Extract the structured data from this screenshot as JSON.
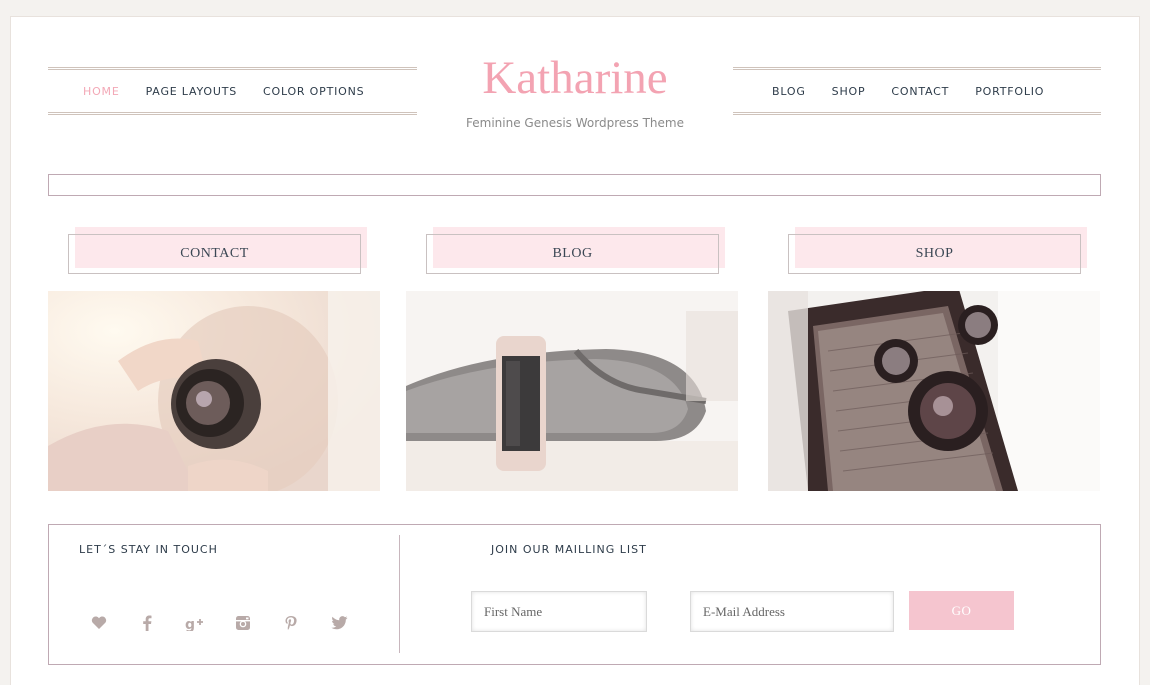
{
  "site": {
    "title": "Katharine",
    "tagline": "Feminine Genesis Wordpress Theme"
  },
  "nav_left": [
    {
      "label": "HOME",
      "active": true
    },
    {
      "label": "PAGE LAYOUTS",
      "active": false
    },
    {
      "label": "COLOR OPTIONS",
      "active": false
    }
  ],
  "nav_right": [
    {
      "label": "BLOG"
    },
    {
      "label": "SHOP"
    },
    {
      "label": "CONTACT"
    },
    {
      "label": "PORTFOLIO"
    }
  ],
  "features": [
    {
      "label": "CONTACT"
    },
    {
      "label": "BLOG"
    },
    {
      "label": "SHOP"
    }
  ],
  "footer_widget": {
    "social_title": "LET´S STAY IN TOUCH",
    "social_icons": [
      "heart-icon",
      "facebook-icon",
      "google-plus-icon",
      "instagram-icon",
      "pinterest-icon",
      "twitter-icon"
    ],
    "mailing_title": "JOIN OUR MAILLING LIST",
    "first_name_placeholder": "First Name",
    "email_placeholder": "E-Mail Address",
    "go_label": "GO"
  },
  "colors": {
    "accent_pink": "#f3a3b2",
    "button_pink": "#f5c5cf",
    "nav_text": "#2e3c4a"
  }
}
